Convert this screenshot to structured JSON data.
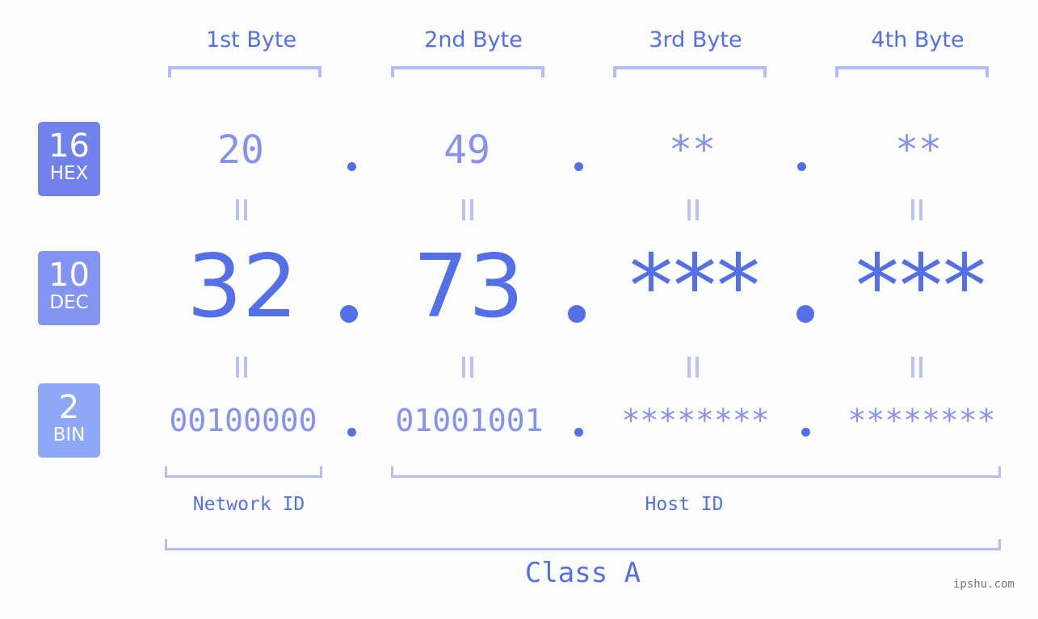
{
  "byte_headers": [
    "1st Byte",
    "2nd Byte",
    "3rd Byte",
    "4th Byte"
  ],
  "badges": {
    "hex": {
      "number": "16",
      "label": "HEX",
      "color": "#7282ec"
    },
    "dec": {
      "number": "10",
      "label": "DEC",
      "color": "#8494f2"
    },
    "bin": {
      "number": "2",
      "label": "BIN",
      "color": "#8ea8f8"
    }
  },
  "hex_values": [
    "20",
    "49",
    "**",
    "**"
  ],
  "dec_values": [
    "32",
    "73",
    "***",
    "***"
  ],
  "bin_values": [
    "00100000",
    "01001001",
    "********",
    "********"
  ],
  "separator": ".",
  "network_id_label": "Network ID",
  "host_id_label": "Host ID",
  "class_label": "Class A",
  "watermark": "ipshu.com",
  "colors": {
    "accent": "#5470e8",
    "muted": "#8593ef",
    "bracket": "#b3bdf7"
  }
}
